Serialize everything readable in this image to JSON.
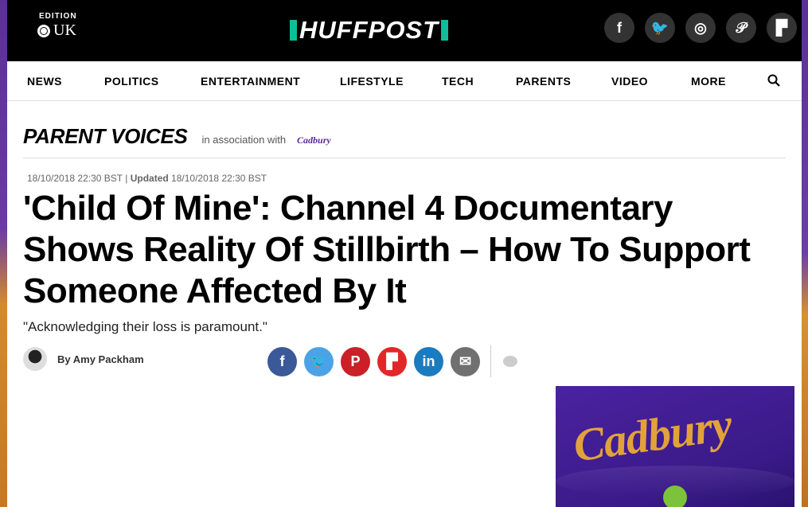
{
  "header": {
    "edition_label": "EDITION",
    "edition_value": "UK",
    "logo_text": "HUFFPOST",
    "social": [
      {
        "name": "facebook-icon",
        "glyph": "f"
      },
      {
        "name": "twitter-icon",
        "glyph": "🐦"
      },
      {
        "name": "instagram-icon",
        "glyph": "◎"
      },
      {
        "name": "pinterest-icon",
        "glyph": "𝒫"
      },
      {
        "name": "flipboard-icon",
        "glyph": "▛"
      }
    ]
  },
  "nav": {
    "items": [
      "NEWS",
      "POLITICS",
      "ENTERTAINMENT",
      "LIFESTYLE",
      "TECH",
      "PARENTS",
      "VIDEO",
      "MORE"
    ]
  },
  "section": {
    "title": "PARENT VOICES",
    "association": "in association with",
    "sponsor": "Cadbury"
  },
  "article": {
    "published": "18/10/2018 22:30 BST",
    "separator": "|",
    "updated_label": "Updated",
    "updated": "18/10/2018 22:30 BST",
    "headline": "'Child Of Mine': Channel 4 Documentary Shows Reality Of Stillbirth – How To Support Someone Affected By It",
    "subhead": "\"Acknowledging their loss is paramount.\"",
    "byline": "By Amy Packham"
  },
  "share": [
    {
      "name": "share-facebook-button",
      "glyph": "f",
      "color": "#3b5998"
    },
    {
      "name": "share-twitter-button",
      "glyph": "🐦",
      "color": "#4aa3e6"
    },
    {
      "name": "share-pinterest-button",
      "glyph": "P",
      "color": "#cb2027"
    },
    {
      "name": "share-flipboard-button",
      "glyph": "▛",
      "color": "#e12828"
    },
    {
      "name": "share-linkedin-button",
      "glyph": "in",
      "color": "#1b7bbf"
    },
    {
      "name": "share-email-button",
      "glyph": "✉",
      "color": "#707070"
    }
  ],
  "ad": {
    "brand": "Cadbury"
  },
  "colors": {
    "brand_green": "#0dbe98",
    "topbar": "#000000",
    "ad_purple": "#4a22a0"
  }
}
